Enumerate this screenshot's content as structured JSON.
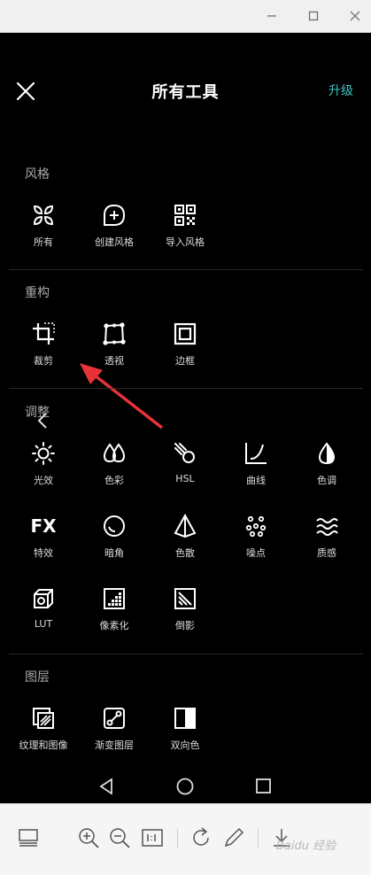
{
  "window": {
    "minimize_icon": "minimize-icon",
    "maximize_icon": "maximize-icon",
    "close_icon": "close-icon"
  },
  "header": {
    "title": "所有工具",
    "upgrade_label": "升级"
  },
  "sections": {
    "style": {
      "title": "风格",
      "items": [
        "所有",
        "创建风格",
        "导入风格"
      ]
    },
    "restructure": {
      "title": "重构",
      "items": [
        "裁剪",
        "透视",
        "边框"
      ]
    },
    "adjust": {
      "title": "调整",
      "items": [
        "光效",
        "色彩",
        "HSL",
        "曲线",
        "色调",
        "特效",
        "暗角",
        "色散",
        "噪点",
        "质感",
        "LUT",
        "像素化",
        "倒影"
      ]
    },
    "layers": {
      "title": "图层",
      "items": [
        "纹理和图像",
        "渐变图层",
        "双向色"
      ]
    }
  },
  "fx_text": "FX",
  "colors": {
    "accent": "#3fc5c5",
    "arrow": "#e8323a"
  },
  "watermark": "Baidu 经验"
}
